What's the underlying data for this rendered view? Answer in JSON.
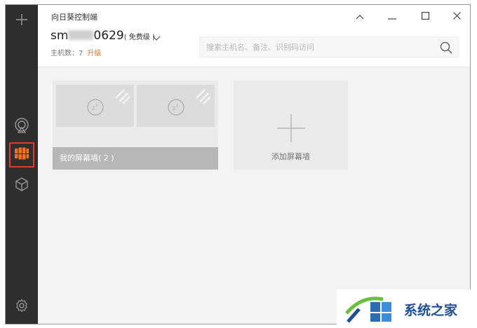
{
  "app": {
    "title": "向日葵控制端"
  },
  "user": {
    "name_prefix": "sm",
    "name_suffix": "0629",
    "tier": "( 免费级 )",
    "host_count": "主机数：7",
    "upgrade": "升级"
  },
  "search": {
    "placeholder": "搜索主机名、备注、识别码访问"
  },
  "walls": [
    {
      "label": "我的屏幕墙( 2 )",
      "thumbnails": 2
    }
  ],
  "add_wall": {
    "label": "添加屏幕墙"
  },
  "sidebar": {
    "icons": [
      "plus-icon",
      "remote-icon",
      "screen-wall-icon",
      "cube-icon",
      "settings-icon"
    ],
    "active": "screen-wall-icon"
  },
  "colors": {
    "sidebar_bg": "#2e2e2e",
    "accent": "#f0721c",
    "active_outline": "#e23a2a",
    "wall_footer": "#b7b7b7"
  },
  "watermark": {
    "text": "系统之家"
  }
}
